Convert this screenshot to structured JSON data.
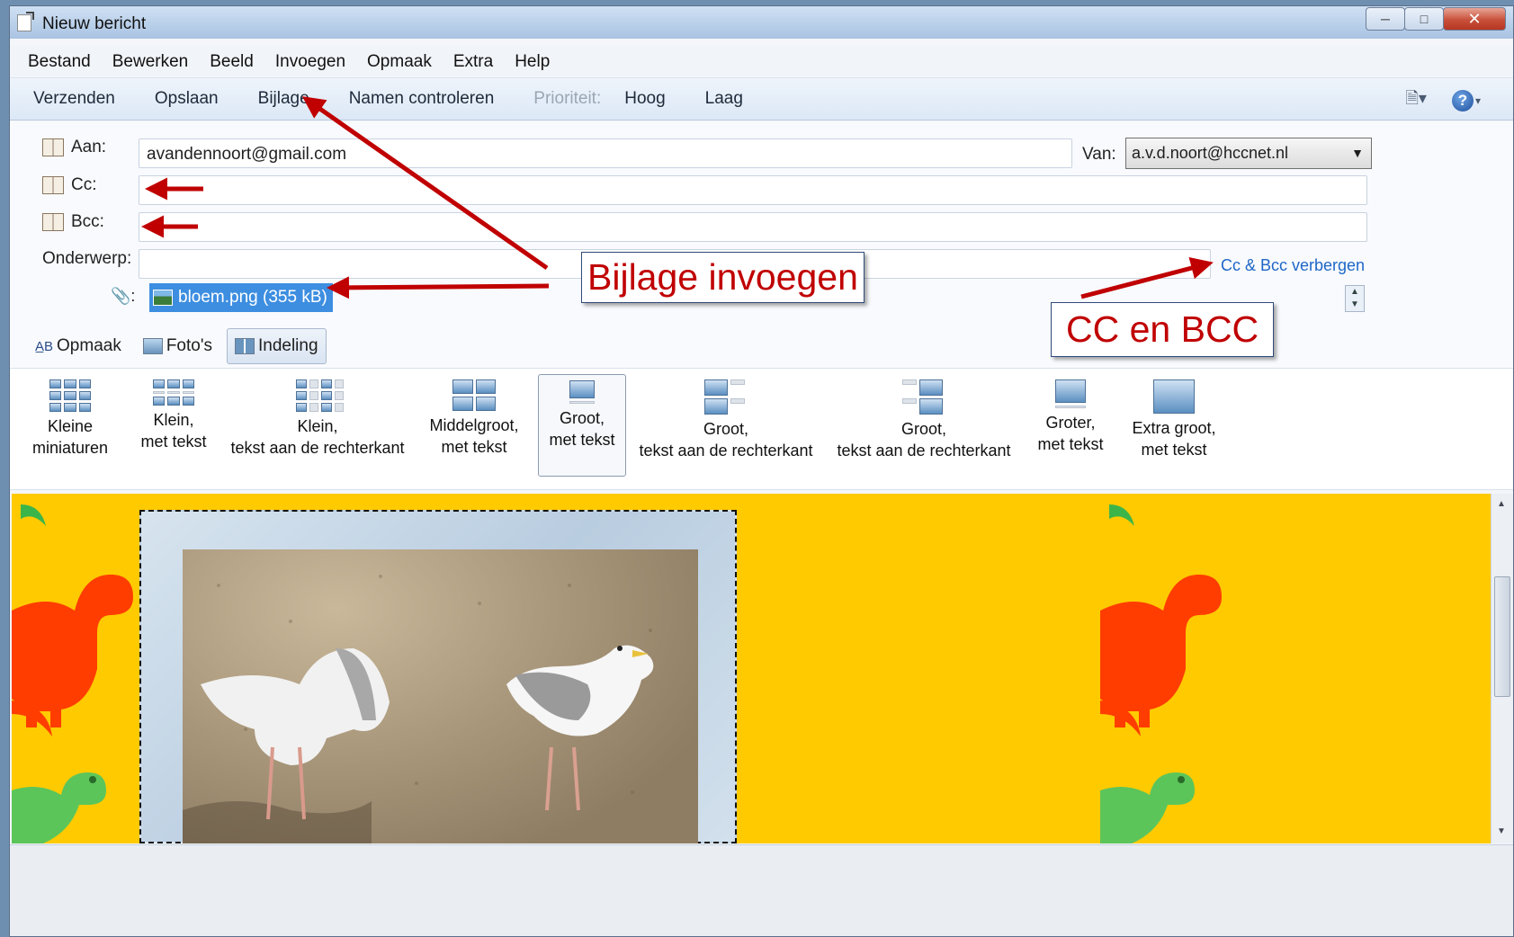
{
  "window": {
    "title": "Nieuw bericht"
  },
  "menu": [
    "Bestand",
    "Bewerken",
    "Beeld",
    "Invoegen",
    "Opmaak",
    "Extra",
    "Help"
  ],
  "toolbar": {
    "send": "Verzenden",
    "save": "Opslaan",
    "attach": "Bijlage",
    "check_names": "Namen controleren",
    "priority_label": "Prioriteit:",
    "high": "Hoog",
    "low": "Laag"
  },
  "fields": {
    "to_label": "Aan:",
    "to_value": "avandennoort@gmail.com",
    "cc_label": "Cc:",
    "cc_value": "",
    "bcc_label": "Bcc:",
    "bcc_value": "",
    "subject_label": "Onderwerp:",
    "subject_value": "",
    "from_label": "Van:",
    "from_value": "a.v.d.noort@hccnet.nl",
    "hide_cc_bcc": "Cc & Bcc verbergen",
    "attachment_clip": "📎:",
    "attachment": "bloem.png (355 kB)"
  },
  "tabs": [
    {
      "label": "Opmaak",
      "icon": "format-text-icon"
    },
    {
      "label": "Foto's",
      "icon": "photo-icon"
    },
    {
      "label": "Indeling",
      "icon": "layout-icon",
      "active": true
    }
  ],
  "layouts": [
    {
      "line1": "Kleine",
      "line2": "miniaturen"
    },
    {
      "line1": "Klein,",
      "line2": "met tekst"
    },
    {
      "line1": "Klein,",
      "line2": "tekst aan de rechterkant"
    },
    {
      "line1": "Middelgroot,",
      "line2": "met tekst"
    },
    {
      "line1": "Groot,",
      "line2": "met tekst",
      "selected": true
    },
    {
      "line1": "Groot,",
      "line2": "tekst aan de rechterkant"
    },
    {
      "line1": "Groot,",
      "line2": "tekst aan de rechterkant"
    },
    {
      "line1": "Groter,",
      "line2": "met tekst"
    },
    {
      "line1": "Extra groot,",
      "line2": "met tekst"
    }
  ],
  "annotations": {
    "attach_callout": "Bijlage invoegen",
    "cc_callout": "CC en BCC",
    "arrow_color": "#c00000"
  },
  "colors": {
    "editor_background": "#ffca00",
    "attachment_highlight": "#3d8ee0",
    "link": "#1f67c7"
  }
}
